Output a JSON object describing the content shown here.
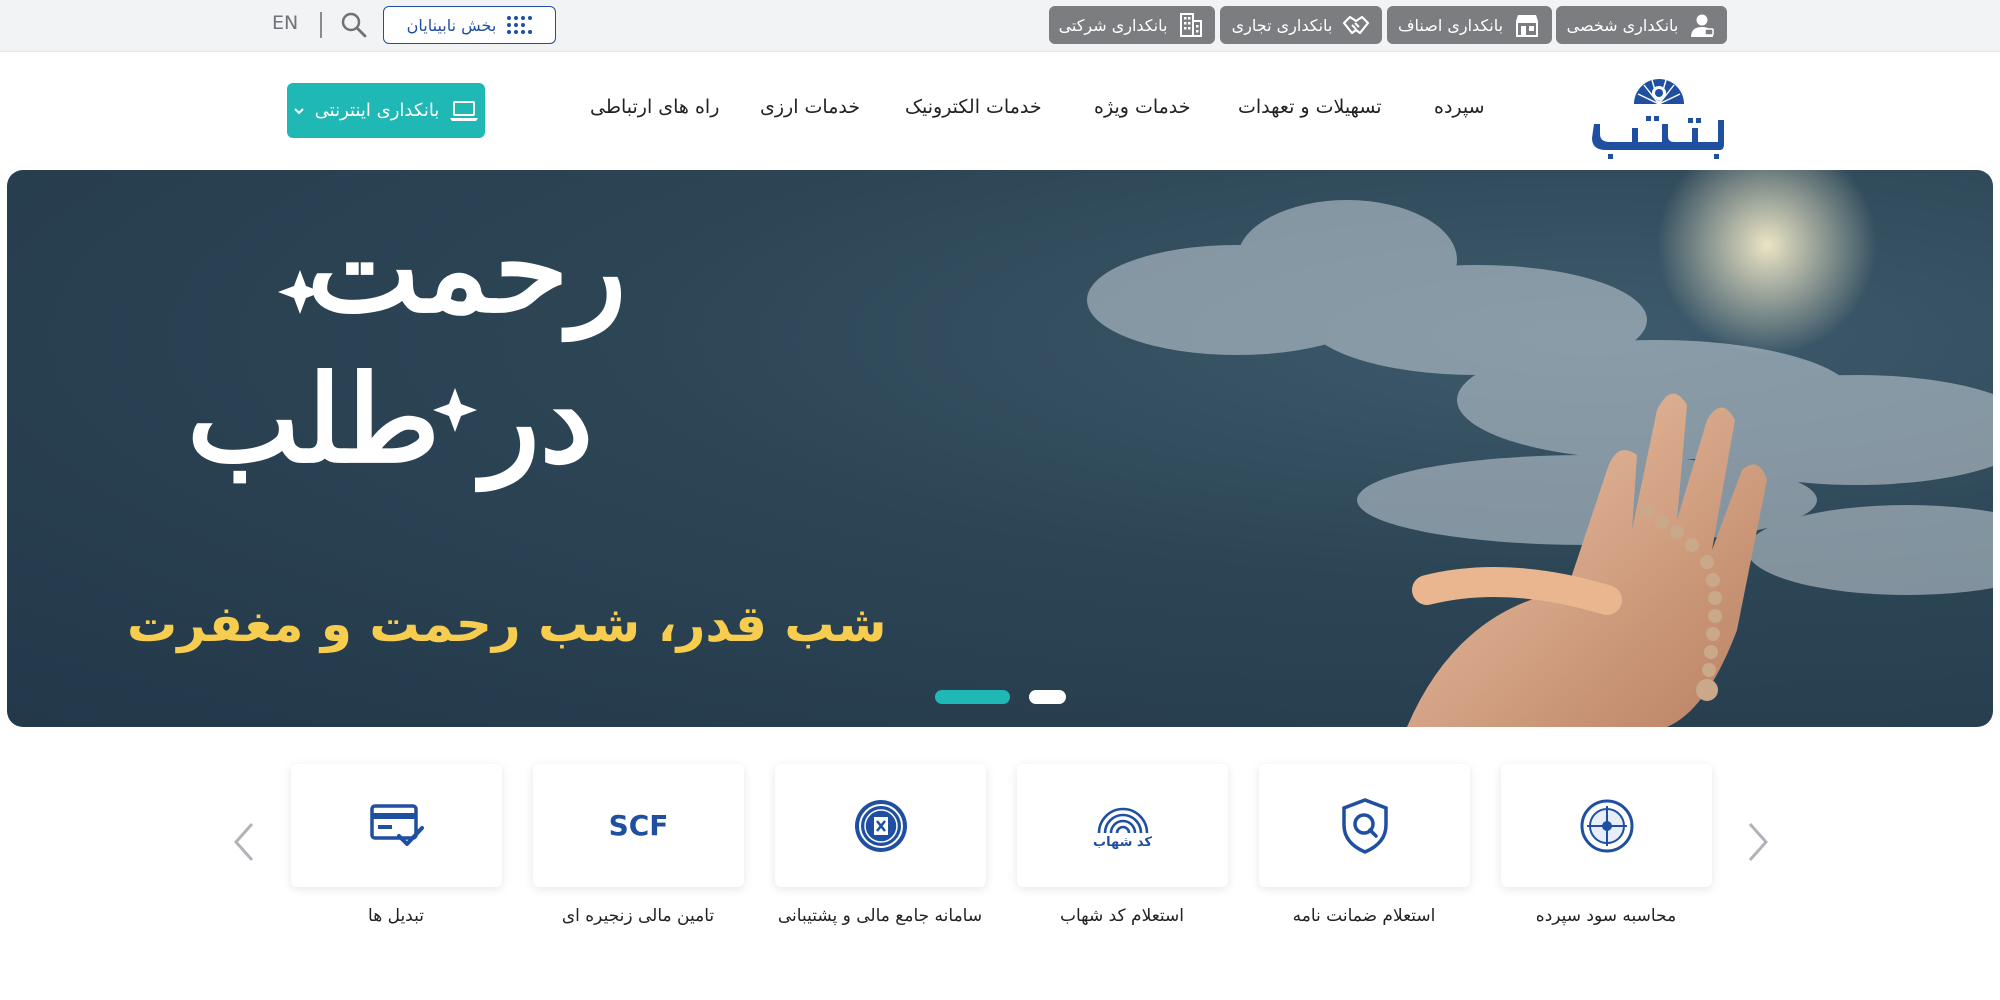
{
  "topbar": {
    "segments": [
      {
        "label": "بانکداری شخصی",
        "icon": "person-icon"
      },
      {
        "label": "بانکداری اصناف",
        "icon": "shop-icon"
      },
      {
        "label": "بانکداری تجاری",
        "icon": "handshake-icon"
      },
      {
        "label": "بانکداری شرکتی",
        "icon": "building-icon"
      }
    ],
    "blind_section": "بخش نابینایان",
    "language": "EN"
  },
  "header": {
    "nav": [
      "سپرده",
      "تسهیلات و تعهدات",
      "خدمات ویژه",
      "خدمات الکترونیک",
      "خدمات ارزی",
      "راه های ارتباطی"
    ],
    "internet_banking": "بانکداری اینترنتی"
  },
  "hero": {
    "calligraphy_line1": "رحمت",
    "calligraphy_line2": "در طلب",
    "tagline": "شب قدر، شب رحمت و مغفرت",
    "slides": 2,
    "active_slide": 1
  },
  "services": [
    {
      "label": "محاسبه سود سپرده",
      "icon": "compass-icon"
    },
    {
      "label": "استعلام ضمانت نامه",
      "icon": "shield-search-icon"
    },
    {
      "label": "استعلام کد شهاب",
      "icon": "fingerprint-icon",
      "icon_text": "کد شهاب"
    },
    {
      "label": "سامانه جامع مالی و پشتیبانی",
      "icon": "finance-system-icon"
    },
    {
      "label": "تامین مالی زنجیره ای",
      "icon": "scf-icon",
      "icon_text": "SCF"
    },
    {
      "label": "تبدیل ها",
      "icon": "card-check-icon"
    }
  ],
  "colors": {
    "brand_blue": "#1f4fa0",
    "teal": "#1fb8b5",
    "segment_gray": "#7b7d80",
    "tagline_yellow": "#f6cd4f"
  }
}
